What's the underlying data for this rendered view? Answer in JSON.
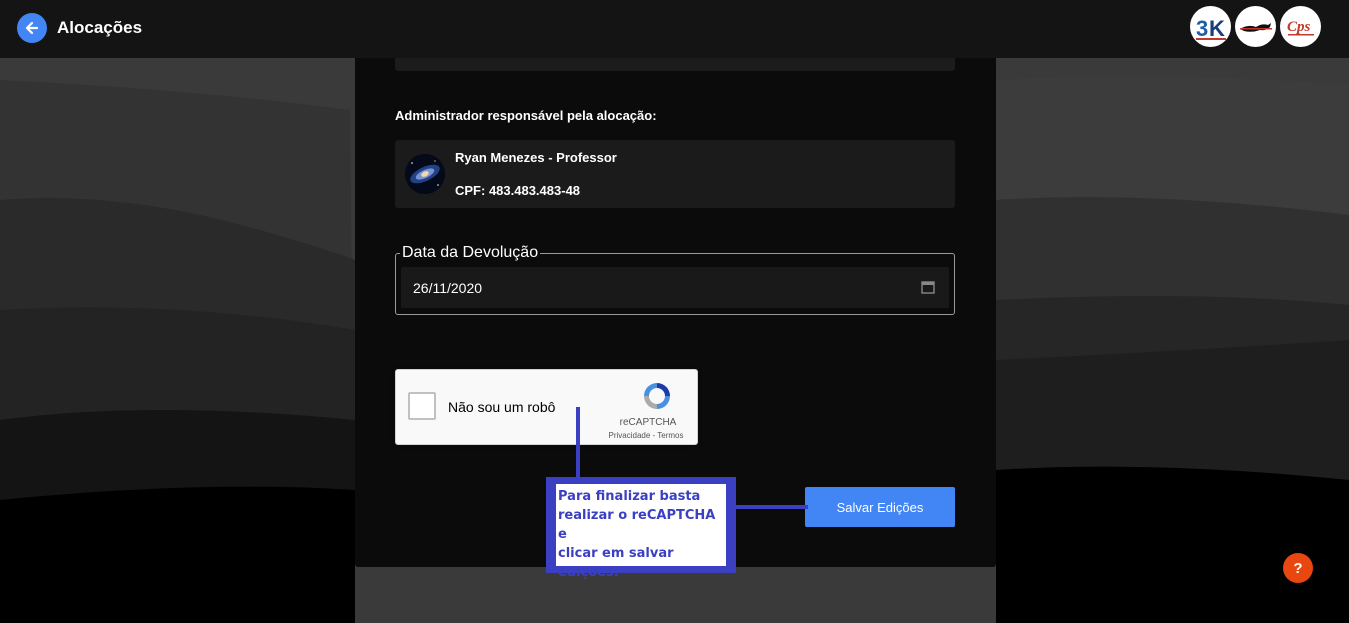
{
  "header": {
    "title": "Alocações",
    "logos": [
      {
        "name": "cps-3k-logo",
        "text": "3K"
      },
      {
        "name": "mustang-logo"
      },
      {
        "name": "cps-logo",
        "text": "Cps"
      }
    ]
  },
  "admin": {
    "section_label": "Administrador responsável pela alocação:",
    "name": "Ryan Menezes - Professor",
    "cpf": "CPF: 483.483.483-48"
  },
  "return_date": {
    "label": "Data da Devolução",
    "value": "26/11/2020"
  },
  "recaptcha": {
    "label": "Não sou um robô",
    "brand": "reCAPTCHA",
    "links": "Privacidade - Termos"
  },
  "actions": {
    "save_label": "Salvar Edições",
    "help_label": "?"
  },
  "annotation": {
    "text_lines": [
      "Para finalizar basta",
      "realizar o reCAPTCHA e",
      "clicar em salvar edições."
    ]
  },
  "colors": {
    "accent": "#4285f4",
    "annotation": "#3b3fc2",
    "help": "#e8470f"
  }
}
